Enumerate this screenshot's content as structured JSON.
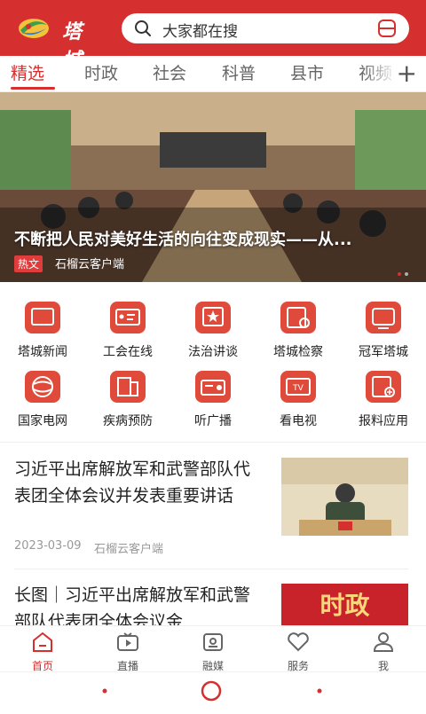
{
  "app": {
    "logo_text": "塔城",
    "brand_color": "#d62f2f"
  },
  "search": {
    "placeholder": "大家都在搜"
  },
  "tabs": [
    {
      "label": "精选",
      "active": true
    },
    {
      "label": "时政"
    },
    {
      "label": "社会"
    },
    {
      "label": "科普"
    },
    {
      "label": "县市"
    },
    {
      "label": "视频"
    }
  ],
  "banner": {
    "title": "不断把人民对美好生活的向往变成现实——从...",
    "tag": "热文",
    "source": "石榴云客户端"
  },
  "services": [
    {
      "label": "塔城新闻",
      "icon": "tacheng-news-icon"
    },
    {
      "label": "工会在线",
      "icon": "union-card-icon"
    },
    {
      "label": "法治讲谈",
      "icon": "law-star-icon"
    },
    {
      "label": "塔城检察",
      "icon": "procuratorate-icon"
    },
    {
      "label": "冠军塔城",
      "icon": "champion-icon"
    },
    {
      "label": "国家电网",
      "icon": "state-grid-icon"
    },
    {
      "label": "疾病预防",
      "icon": "disease-prevention-icon"
    },
    {
      "label": "听广播",
      "icon": "radio-icon"
    },
    {
      "label": "看电视",
      "icon": "tv-icon"
    },
    {
      "label": "报料应用",
      "icon": "report-icon"
    }
  ],
  "news": [
    {
      "title": "习近平出席解放军和武警部队代表团全体会议并发表重要讲话",
      "date": "2023-03-09",
      "source": "石榴云客户端"
    },
    {
      "title": "长图｜习近平出席解放军和武警部队代表团全体会议金",
      "thumb_text": "时政"
    }
  ],
  "bottom_nav": [
    {
      "label": "首页",
      "icon": "home-icon",
      "active": true
    },
    {
      "label": "直播",
      "icon": "live-icon"
    },
    {
      "label": "融媒",
      "icon": "media-icon"
    },
    {
      "label": "服务",
      "icon": "service-heart-icon"
    },
    {
      "label": "我",
      "icon": "profile-icon"
    }
  ]
}
